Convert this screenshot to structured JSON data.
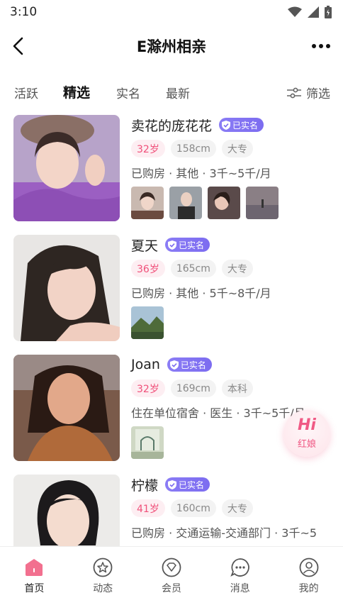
{
  "status_bar": {
    "time": "3:10"
  },
  "header": {
    "title": "E滁州相亲"
  },
  "tabs": [
    {
      "label": "活跃",
      "active": false
    },
    {
      "label": "精选",
      "active": true
    },
    {
      "label": "实名",
      "active": false
    },
    {
      "label": "最新",
      "active": false
    }
  ],
  "filter": {
    "label": "筛选"
  },
  "verified_label": "已实名",
  "profiles": [
    {
      "name": "卖花的庞花花",
      "age": "32岁",
      "height": "158cm",
      "education": "大专",
      "info": "已购房 · 其他 · 3千~5千/月",
      "photos": 4
    },
    {
      "name": "夏天",
      "age": "36岁",
      "height": "165cm",
      "education": "大专",
      "info": "已购房 · 其他 · 5千~8千/月",
      "photos": 1
    },
    {
      "name": "Joan",
      "age": "32岁",
      "height": "169cm",
      "education": "本科",
      "info": "住在单位宿舍 · 医生 · 3千~5千/月",
      "photos": 1
    },
    {
      "name": "柠檬",
      "age": "41岁",
      "height": "160cm",
      "education": "大专",
      "info": "已购房 · 交通运输-交通部门 · 3千~5",
      "photos": 0
    }
  ],
  "hongniang": {
    "hi_text": "Hi",
    "label": "红娘"
  },
  "bottom_nav": [
    {
      "label": "首页",
      "icon": "home-icon",
      "active": true
    },
    {
      "label": "动态",
      "icon": "star-circle-icon",
      "active": false
    },
    {
      "label": "会员",
      "icon": "diamond-circle-icon",
      "active": false
    },
    {
      "label": "消息",
      "icon": "chat-bubble-icon",
      "active": false
    },
    {
      "label": "我的",
      "icon": "profile-icon",
      "active": false
    }
  ],
  "colors": {
    "accent": "#f0507a",
    "verified": "#7c6cf0",
    "tab_underline": "#f7a6c0"
  }
}
